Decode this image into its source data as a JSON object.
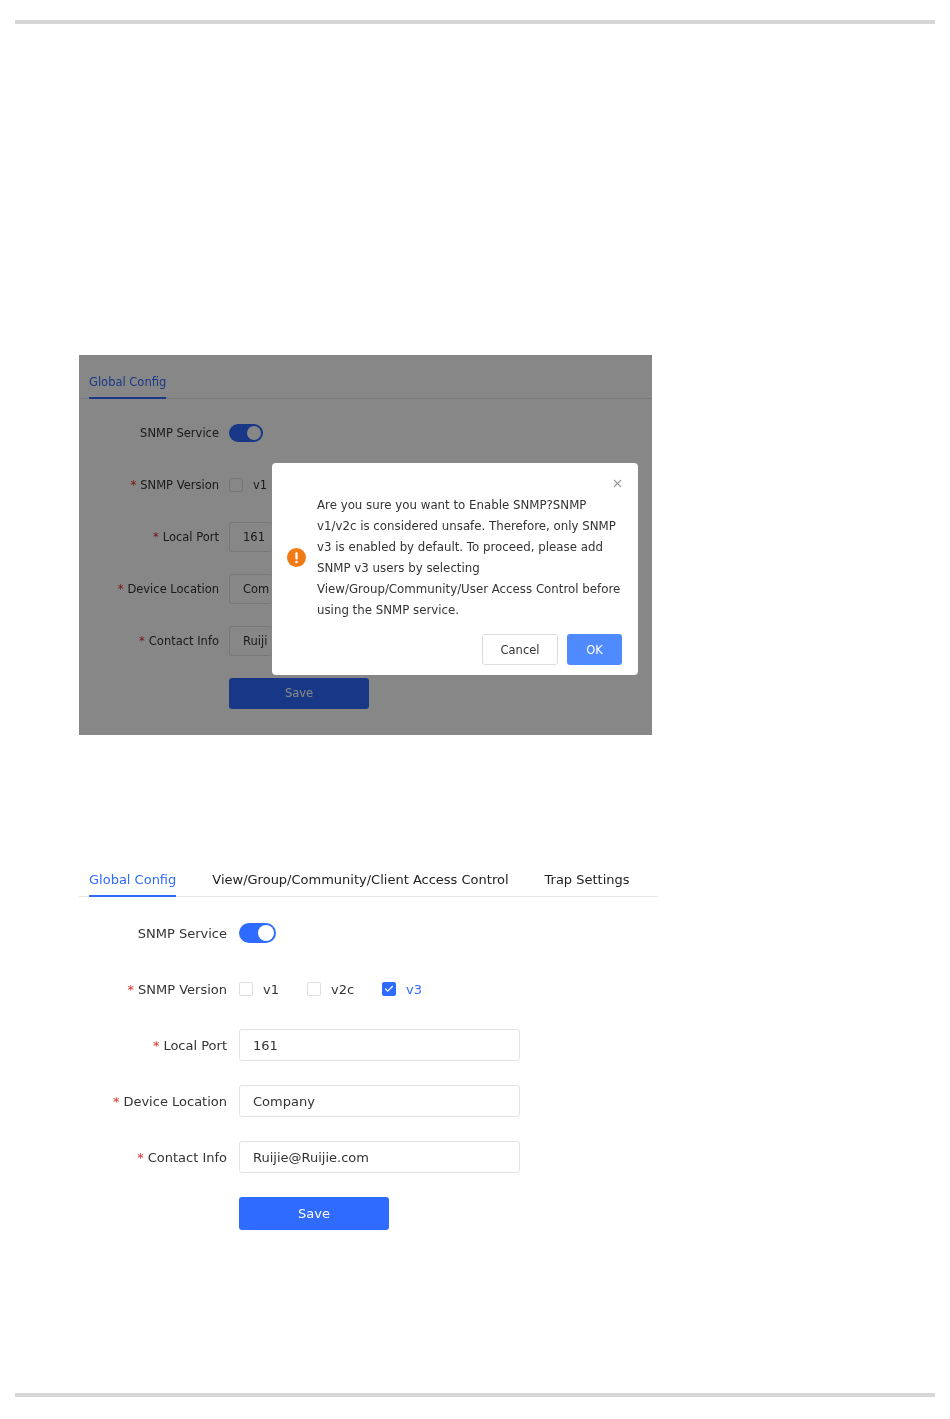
{
  "screenshots": [
    {
      "tabs": [
        {
          "label": "Global Config",
          "selected": true
        }
      ],
      "service": {
        "label": "SNMP Service",
        "on": true
      },
      "version": {
        "label": "SNMP Version",
        "marker": "*",
        "options": [
          {
            "label": "v1",
            "checked": false
          }
        ]
      },
      "fields": [
        {
          "label": "Local Port",
          "marker": "*",
          "value": "161"
        },
        {
          "label": "Device Location",
          "marker": "*",
          "value": "Com"
        },
        {
          "label": "Contact Info",
          "marker": "*",
          "value": "Ruiji"
        }
      ],
      "save_button": "Save",
      "dialog": {
        "message": "Are you sure you want to Enable SNMP?SNMP v1/v2c is considered unsafe. Therefore, only SNMP v3 is enabled by default. To proceed, please add SNMP v3 users by selecting View/Group/Community/User Access Control before using the SNMP service.",
        "cancel_button": "Cancel",
        "ok_button": "OK"
      }
    },
    {
      "tabs": [
        {
          "label": "Global Config",
          "selected": true
        },
        {
          "label": "View/Group/Community/Client Access Control",
          "selected": false
        },
        {
          "label": "Trap Settings",
          "selected": false
        }
      ],
      "service": {
        "label": "SNMP Service",
        "on": true
      },
      "version": {
        "label": "SNMP Version",
        "marker": "*",
        "options": [
          {
            "label": "v1",
            "checked": false
          },
          {
            "label": "v2c",
            "checked": false
          },
          {
            "label": "v3",
            "checked": true
          }
        ]
      },
      "fields": [
        {
          "label": "Local Port",
          "marker": "*",
          "value": "161"
        },
        {
          "label": "Device Location",
          "marker": "*",
          "value": "Company"
        },
        {
          "label": "Contact Info",
          "marker": "*",
          "value": "Ruijie@Ruijie.com"
        }
      ],
      "save_button": "Save"
    }
  ]
}
